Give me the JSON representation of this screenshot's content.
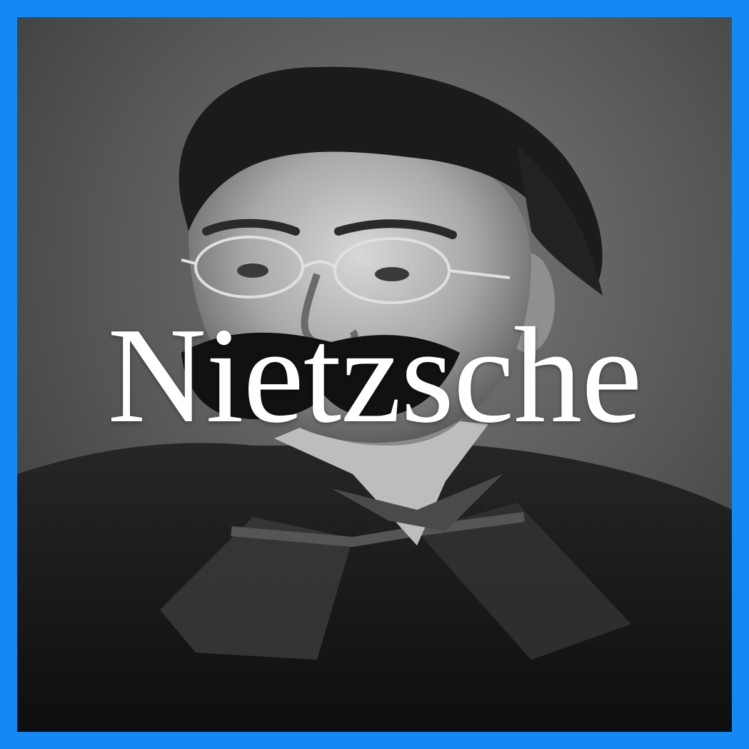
{
  "poster": {
    "title": "Nietzsche",
    "frame_color": "#1389f5",
    "title_color": "#ffffff",
    "photo_style": "black-and-white portrait"
  }
}
